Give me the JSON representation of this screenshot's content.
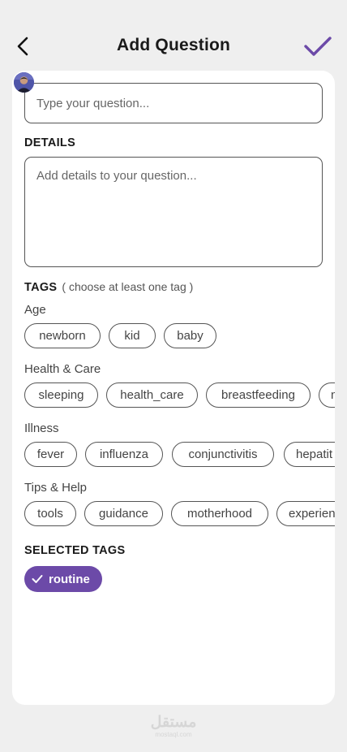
{
  "header": {
    "title": "Add Question",
    "back_icon": "chevron-left-icon",
    "confirm_icon": "check-icon",
    "accent_color": "#6c4aa8"
  },
  "form": {
    "question_placeholder": "Type your question...",
    "details_label": "DETAILS",
    "details_placeholder": "Add details to your question...",
    "tags_label": "TAGS",
    "tags_hint": "( choose at least one tag )"
  },
  "categories": [
    {
      "name": "Age",
      "tags": [
        "newborn",
        "kid",
        "baby"
      ]
    },
    {
      "name": "Health & Care",
      "tags": [
        "sleeping",
        "health_care",
        "breastfeeding",
        "n"
      ]
    },
    {
      "name": "Illness",
      "tags": [
        "fever",
        "influenza",
        "conjunctivitis",
        "hepatit"
      ]
    },
    {
      "name": "Tips & Help",
      "tags": [
        "tools",
        "guidance",
        "motherhood",
        "experien"
      ]
    }
  ],
  "selected": {
    "label": "SELECTED TAGS",
    "tags": [
      "routine"
    ]
  },
  "watermark": {
    "main": "مستقل",
    "sub": "mostaql.com"
  }
}
